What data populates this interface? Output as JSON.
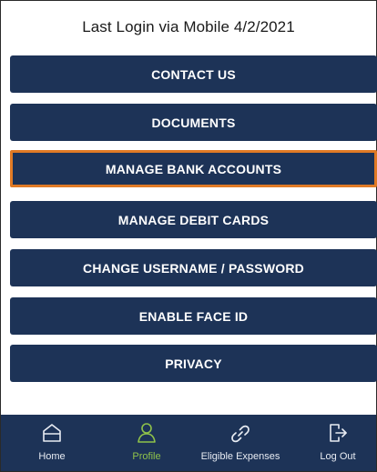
{
  "header": {
    "last_login": "Last Login via Mobile 4/2/2021"
  },
  "menu": {
    "items": [
      {
        "label": "CONTACT US"
      },
      {
        "label": "DOCUMENTS"
      },
      {
        "label": "MANAGE BANK ACCOUNTS",
        "highlighted": true
      },
      {
        "label": "MANAGE DEBIT CARDS"
      },
      {
        "label": "CHANGE USERNAME / PASSWORD"
      },
      {
        "label": "ENABLE FACE ID"
      },
      {
        "label": "PRIVACY"
      }
    ]
  },
  "tabbar": {
    "tabs": [
      {
        "label": "Home",
        "icon": "home-icon"
      },
      {
        "label": "Profile",
        "icon": "profile-icon",
        "active": true
      },
      {
        "label": "Eligible Expenses",
        "icon": "link-icon"
      },
      {
        "label": "Log Out",
        "icon": "logout-icon"
      }
    ]
  },
  "colors": {
    "brand_navy": "#1d3357",
    "highlight_orange": "#e07a25",
    "active_tab_green": "#8fc24a"
  }
}
